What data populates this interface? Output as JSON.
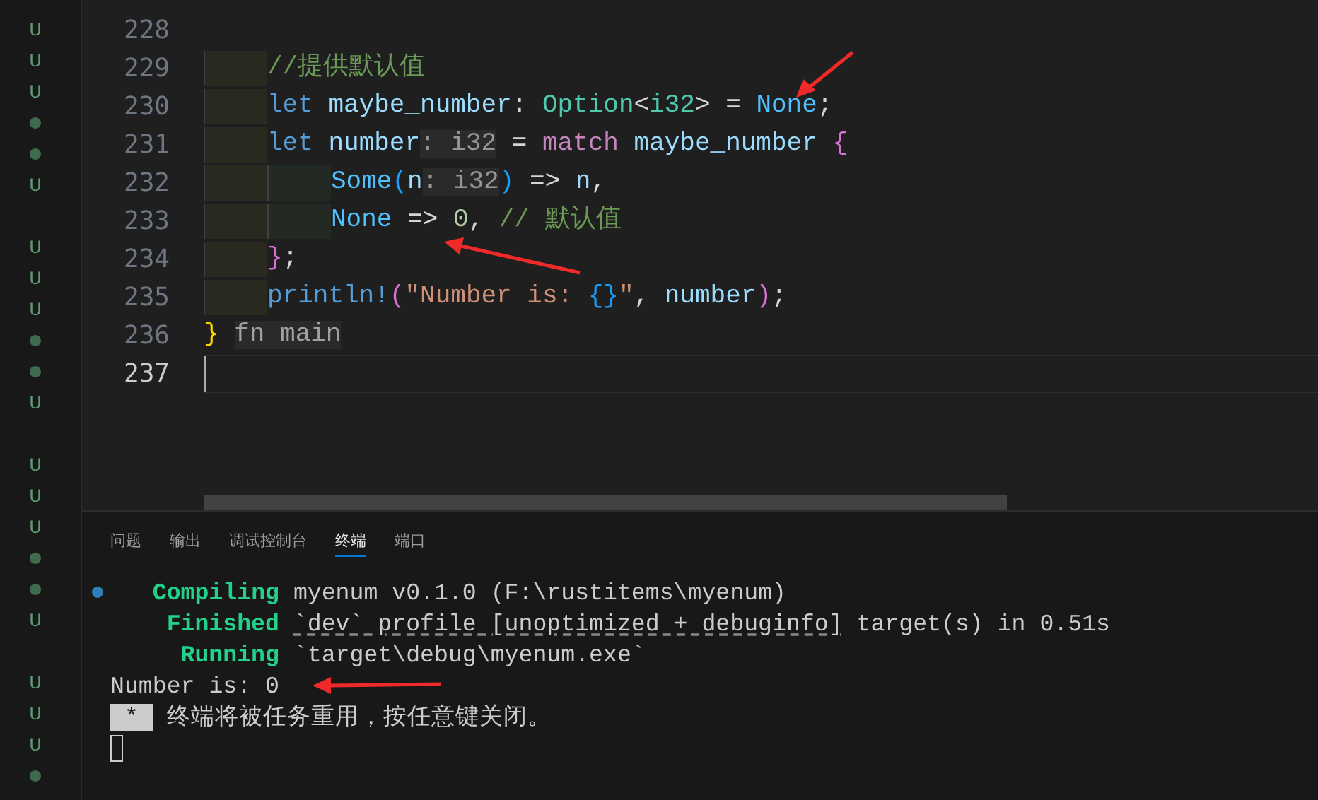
{
  "gutter_markers": [
    {
      "kind": "untracked",
      "text": "U"
    },
    {
      "kind": "untracked",
      "text": "U"
    },
    {
      "kind": "untracked",
      "text": "U"
    },
    {
      "kind": "dot"
    },
    {
      "kind": "dot"
    },
    {
      "kind": "untracked",
      "text": "U"
    },
    {
      "kind": "blank"
    },
    {
      "kind": "untracked",
      "text": "U"
    },
    {
      "kind": "untracked",
      "text": "U"
    },
    {
      "kind": "untracked",
      "text": "U"
    },
    {
      "kind": "dot"
    },
    {
      "kind": "dot"
    },
    {
      "kind": "untracked",
      "text": "U"
    },
    {
      "kind": "blank"
    },
    {
      "kind": "untracked",
      "text": "U"
    },
    {
      "kind": "untracked",
      "text": "U"
    },
    {
      "kind": "untracked",
      "text": "U"
    },
    {
      "kind": "dot"
    },
    {
      "kind": "dot"
    },
    {
      "kind": "untracked",
      "text": "U"
    },
    {
      "kind": "blank"
    },
    {
      "kind": "untracked",
      "text": "U"
    },
    {
      "kind": "untracked",
      "text": "U"
    },
    {
      "kind": "untracked",
      "text": "U"
    },
    {
      "kind": "dot"
    }
  ],
  "editor": {
    "lines": [
      {
        "number": "228",
        "kind": "top",
        "current": false
      },
      {
        "number": "229",
        "kind": "body",
        "current": false,
        "tokens": [
          {
            "kind": "comment",
            "text": "//提供默认值"
          }
        ]
      },
      {
        "number": "230",
        "kind": "body",
        "current": false,
        "tokens": [
          {
            "kind": "kw",
            "text": "let "
          },
          {
            "kind": "var",
            "text": "maybe_number"
          },
          {
            "kind": "punc",
            "text": ": "
          },
          {
            "kind": "type",
            "text": "Option"
          },
          {
            "kind": "punc",
            "text": "<"
          },
          {
            "kind": "type",
            "text": "i32"
          },
          {
            "kind": "punc",
            "text": "> = "
          },
          {
            "kind": "const",
            "text": "None"
          },
          {
            "kind": "punc",
            "text": ";"
          }
        ]
      },
      {
        "number": "231",
        "kind": "body",
        "current": false,
        "tokens": [
          {
            "kind": "kw",
            "text": "let "
          },
          {
            "kind": "var",
            "text": "number"
          },
          {
            "kind": "hint",
            "text": ": i32"
          },
          {
            "kind": "punc",
            "text": " = "
          },
          {
            "kind": "ctrl",
            "text": "match "
          },
          {
            "kind": "var",
            "text": "maybe_number "
          },
          {
            "kind": "brace2",
            "text": "{"
          }
        ]
      },
      {
        "number": "232",
        "kind": "arm",
        "current": false,
        "tokens": [
          {
            "kind": "const",
            "text": "Some"
          },
          {
            "kind": "brace3",
            "text": "("
          },
          {
            "kind": "var",
            "text": "n"
          },
          {
            "kind": "hint",
            "text": ": i32"
          },
          {
            "kind": "brace3",
            "text": ")"
          },
          {
            "kind": "punc",
            "text": " => "
          },
          {
            "kind": "var",
            "text": "n"
          },
          {
            "kind": "punc",
            "text": ","
          }
        ]
      },
      {
        "number": "233",
        "kind": "arm",
        "current": false,
        "tokens": [
          {
            "kind": "const",
            "text": "None"
          },
          {
            "kind": "punc",
            "text": " => "
          },
          {
            "kind": "num",
            "text": "0"
          },
          {
            "kind": "punc",
            "text": ", "
          },
          {
            "kind": "comment",
            "text": "// 默认值"
          }
        ]
      },
      {
        "number": "234",
        "kind": "body",
        "current": false,
        "tokens": [
          {
            "kind": "brace2",
            "text": "}"
          },
          {
            "kind": "punc",
            "text": ";"
          }
        ]
      },
      {
        "number": "235",
        "kind": "body",
        "current": false,
        "tokens": [
          {
            "kind": "macro",
            "text": "println!"
          },
          {
            "kind": "brace2",
            "text": "("
          },
          {
            "kind": "str",
            "text": "\"Number is: "
          },
          {
            "kind": "brace3",
            "text": "{}"
          },
          {
            "kind": "str",
            "text": "\""
          },
          {
            "kind": "punc",
            "text": ", "
          },
          {
            "kind": "var",
            "text": "number"
          },
          {
            "kind": "brace2",
            "text": ")"
          },
          {
            "kind": "punc",
            "text": ";"
          }
        ]
      },
      {
        "number": "236",
        "kind": "top",
        "current": false,
        "tokens": [
          {
            "kind": "brace1",
            "text": "}"
          },
          {
            "kind": "sticky",
            "text": "fn main"
          }
        ]
      },
      {
        "number": "237",
        "kind": "top",
        "current": true
      }
    ]
  },
  "panel": {
    "tabs": [
      {
        "label": "问题",
        "selected": false
      },
      {
        "label": "输出",
        "selected": false
      },
      {
        "label": "调试控制台",
        "selected": false
      },
      {
        "label": "终端",
        "selected": true
      },
      {
        "label": "端口",
        "selected": false
      }
    ],
    "terminal": {
      "lines": [
        {
          "kind": "text",
          "decorated": true,
          "parts": [
            {
              "kind": "label",
              "text": "Compiling"
            },
            {
              "kind": "plain",
              "text": "myenum v0.1.0 (F:\\rustitems\\myenum)"
            }
          ]
        },
        {
          "kind": "text",
          "decorated": false,
          "parts": [
            {
              "kind": "label",
              "text": "Finished"
            },
            {
              "kind": "link",
              "text": "`dev` profile [unoptimized + debuginfo]"
            },
            {
              "kind": "plain",
              "text": "target(s) in 0.51s"
            }
          ]
        },
        {
          "kind": "text",
          "decorated": false,
          "parts": [
            {
              "kind": "label",
              "text": "Running"
            },
            {
              "kind": "plain",
              "text": "`target\\debug\\myenum.exe`"
            }
          ]
        },
        {
          "kind": "text",
          "decorated": false,
          "parts": [
            {
              "kind": "plain",
              "text": "Number is: 0"
            }
          ]
        },
        {
          "kind": "text",
          "decorated": false,
          "parts": [
            {
              "kind": "block",
              "text": "*"
            },
            {
              "kind": "plain",
              "text": "终端将被任务重用，按任意键关闭。"
            }
          ]
        },
        {
          "kind": "cursor",
          "decorated": false
        }
      ]
    }
  }
}
